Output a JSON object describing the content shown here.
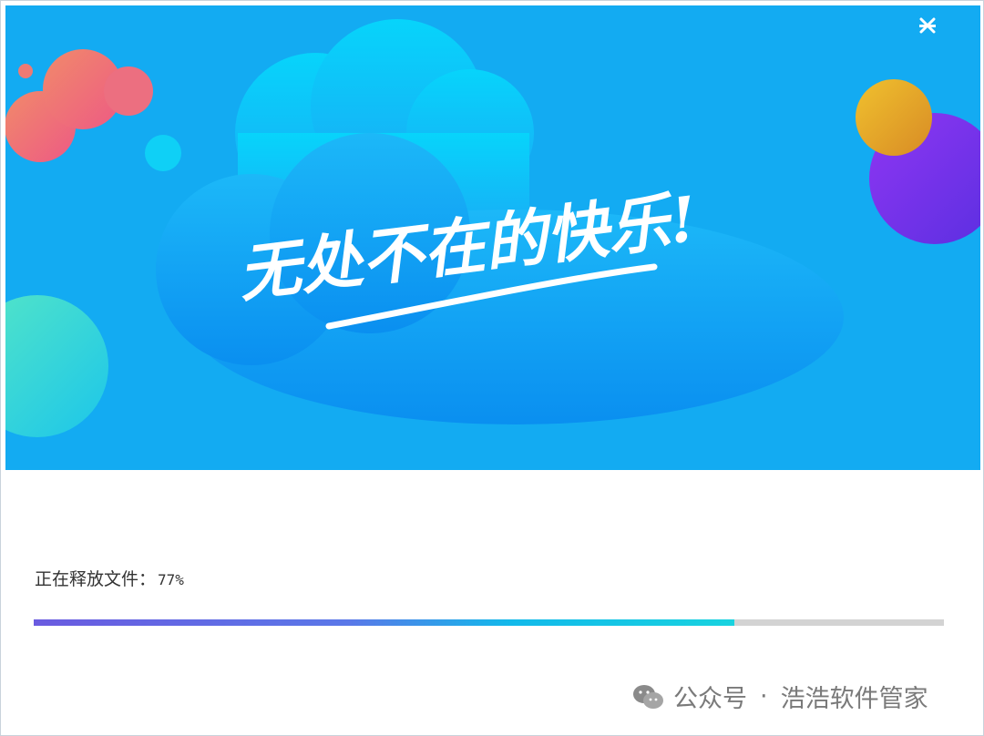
{
  "window": {
    "banner_slogan": "无处不在的快乐!"
  },
  "controls": {
    "minimize_icon": "minimize-icon",
    "close_icon": "close-icon"
  },
  "progress": {
    "label": "正在释放文件：",
    "percent_text": "77%",
    "percent": 77
  },
  "watermark": {
    "icon": "wechat-icon",
    "prefix": "公众号",
    "separator": "·",
    "name": "浩浩软件管家"
  },
  "colors": {
    "banner_bg": "#13abf2",
    "progress_start": "#6a5be0",
    "progress_end": "#19d3df",
    "progress_track": "#d3d3d3"
  }
}
